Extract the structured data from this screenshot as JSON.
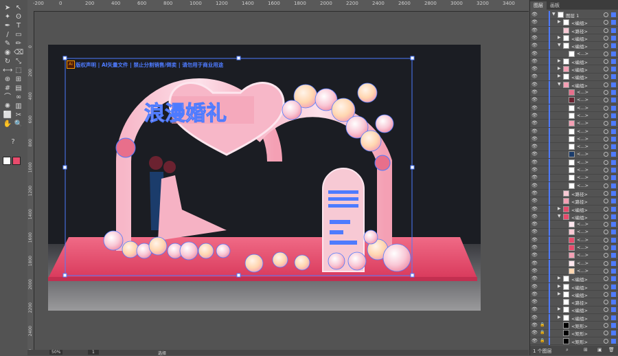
{
  "toolbar": {
    "tools": [
      "selection-tool",
      "direct-selection-tool",
      "magic-wand-tool",
      "lasso-tool",
      "pen-tool",
      "type-tool",
      "line-tool",
      "rectangle-tool",
      "paintbrush-tool",
      "pencil-tool",
      "blob-brush-tool",
      "eraser-tool",
      "rotate-tool",
      "scale-tool",
      "width-tool",
      "free-transform-tool",
      "shape-builder-tool",
      "perspective-grid-tool",
      "mesh-tool",
      "gradient-tool",
      "eyedropper-tool",
      "blend-tool",
      "symbol-sprayer-tool",
      "column-graph-tool",
      "artboard-tool",
      "slice-tool",
      "hand-tool",
      "zoom-tool"
    ],
    "help_glyph": "?"
  },
  "ruler_top_labels": [
    "-200",
    "0",
    "200",
    "400",
    "600",
    "800",
    "1000",
    "1200",
    "1400",
    "1600",
    "1800",
    "2000",
    "2200",
    "2400",
    "2600",
    "2800",
    "3000",
    "3200",
    "3400",
    "3600"
  ],
  "ruler_left_labels": [
    "0",
    "200",
    "400",
    "600",
    "800",
    "1000",
    "1200",
    "1400",
    "1600",
    "1800",
    "2000",
    "2200",
    "2400",
    "2600"
  ],
  "artboard": {
    "badge": "Ai",
    "caption": "版权声明 | AI矢量文件 | 禁止分割销售/倒卖 | 请勿用于商业用途",
    "design_title": "浪漫婚礼",
    "colors": {
      "bg": "#1b1d23",
      "floor": "#e84b6c",
      "pink": "#f4a0b4",
      "light": "#fde6ee",
      "peach": "#ffd6b0",
      "select": "#4e7bff"
    }
  },
  "status": {
    "zoom": "50%",
    "page": "1",
    "mode": "选择"
  },
  "panel": {
    "tabs": [
      "图层",
      "画板"
    ],
    "footer_count": "1 个图层",
    "rows": [
      {
        "name": "图层 1",
        "indent": 0,
        "arrow": "▼",
        "thumb": "#fff"
      },
      {
        "name": "<编组>",
        "indent": 1,
        "arrow": "▶",
        "thumb": "#fff"
      },
      {
        "name": "<路径>",
        "indent": 1,
        "arrow": "",
        "thumb": "#f7c9d4"
      },
      {
        "name": "<编组>",
        "indent": 1,
        "arrow": "▶",
        "thumb": "#fff"
      },
      {
        "name": "<编组>",
        "indent": 1,
        "arrow": "▼",
        "thumb": "#fff"
      },
      {
        "name": "<...>",
        "indent": 2,
        "arrow": "",
        "thumb": "#fff"
      },
      {
        "name": "<编组>",
        "indent": 1,
        "arrow": "▶",
        "thumb": "#fff"
      },
      {
        "name": "<编组>",
        "indent": 1,
        "arrow": "▶",
        "thumb": "#f4a0b4"
      },
      {
        "name": "<编组>",
        "indent": 1,
        "arrow": "▶",
        "thumb": "#fff"
      },
      {
        "name": "<编组>",
        "indent": 1,
        "arrow": "▼",
        "thumb": "#f4a0b4"
      },
      {
        "name": "<...>",
        "indent": 2,
        "arrow": "",
        "thumb": "#e86f8b"
      },
      {
        "name": "<...>",
        "indent": 2,
        "arrow": "",
        "thumb": "#6b2230"
      },
      {
        "name": "<...>",
        "indent": 2,
        "arrow": "",
        "thumb": "#fff"
      },
      {
        "name": "<...>",
        "indent": 2,
        "arrow": "",
        "thumb": "#fff"
      },
      {
        "name": "<...>",
        "indent": 2,
        "arrow": "",
        "thumb": "#f4a0b4"
      },
      {
        "name": "<...>",
        "indent": 2,
        "arrow": "",
        "thumb": "#fff"
      },
      {
        "name": "<...>",
        "indent": 2,
        "arrow": "",
        "thumb": "#fff"
      },
      {
        "name": "<...>",
        "indent": 2,
        "arrow": "",
        "thumb": "#fff"
      },
      {
        "name": "<...>",
        "indent": 2,
        "arrow": "",
        "thumb": "#1b3c6b"
      },
      {
        "name": "<...>",
        "indent": 2,
        "arrow": "",
        "thumb": "#fff"
      },
      {
        "name": "<...>",
        "indent": 2,
        "arrow": "",
        "thumb": "#fff"
      },
      {
        "name": "<...>",
        "indent": 2,
        "arrow": "",
        "thumb": "#fff"
      },
      {
        "name": "<...>",
        "indent": 2,
        "arrow": "",
        "thumb": "#fff"
      },
      {
        "name": "<路径>",
        "indent": 1,
        "arrow": "",
        "thumb": "#f7c9d4"
      },
      {
        "name": "<路径>",
        "indent": 1,
        "arrow": "",
        "thumb": "#f4a0b4"
      },
      {
        "name": "<编组>",
        "indent": 1,
        "arrow": "▶",
        "thumb": "#e84b6c"
      },
      {
        "name": "<编组>",
        "indent": 1,
        "arrow": "▼",
        "thumb": "#e84b6c"
      },
      {
        "name": "<...>",
        "indent": 2,
        "arrow": "",
        "thumb": "#fde6ee"
      },
      {
        "name": "<...>",
        "indent": 2,
        "arrow": "",
        "thumb": "#f7c9d4"
      },
      {
        "name": "<...>",
        "indent": 2,
        "arrow": "",
        "thumb": "#e84b6c"
      },
      {
        "name": "<...>",
        "indent": 2,
        "arrow": "",
        "thumb": "#e84b6c"
      },
      {
        "name": "<...>",
        "indent": 2,
        "arrow": "",
        "thumb": "#f4a0b4"
      },
      {
        "name": "<...>",
        "indent": 2,
        "arrow": "",
        "thumb": "#fde6ee"
      },
      {
        "name": "<...>",
        "indent": 2,
        "arrow": "",
        "thumb": "#ffd6b0"
      },
      {
        "name": "<编组>",
        "indent": 1,
        "arrow": "▶",
        "thumb": "#fff"
      },
      {
        "name": "<编组>",
        "indent": 1,
        "arrow": "▶",
        "thumb": "#fff"
      },
      {
        "name": "<编组>",
        "indent": 1,
        "arrow": "▶",
        "thumb": "#fff"
      },
      {
        "name": "<路径>",
        "indent": 1,
        "arrow": "",
        "thumb": "#fff"
      },
      {
        "name": "<编组>",
        "indent": 1,
        "arrow": "▶",
        "thumb": "#fff"
      },
      {
        "name": "<编组>",
        "indent": 1,
        "arrow": "▶",
        "thumb": "#fff"
      },
      {
        "name": "<矩形>",
        "indent": 1,
        "arrow": "",
        "thumb": "#000"
      },
      {
        "name": "<矩形>",
        "indent": 1,
        "arrow": "",
        "thumb": "#000"
      },
      {
        "name": "<矩形>",
        "indent": 1,
        "arrow": "",
        "thumb": "#000"
      }
    ]
  }
}
